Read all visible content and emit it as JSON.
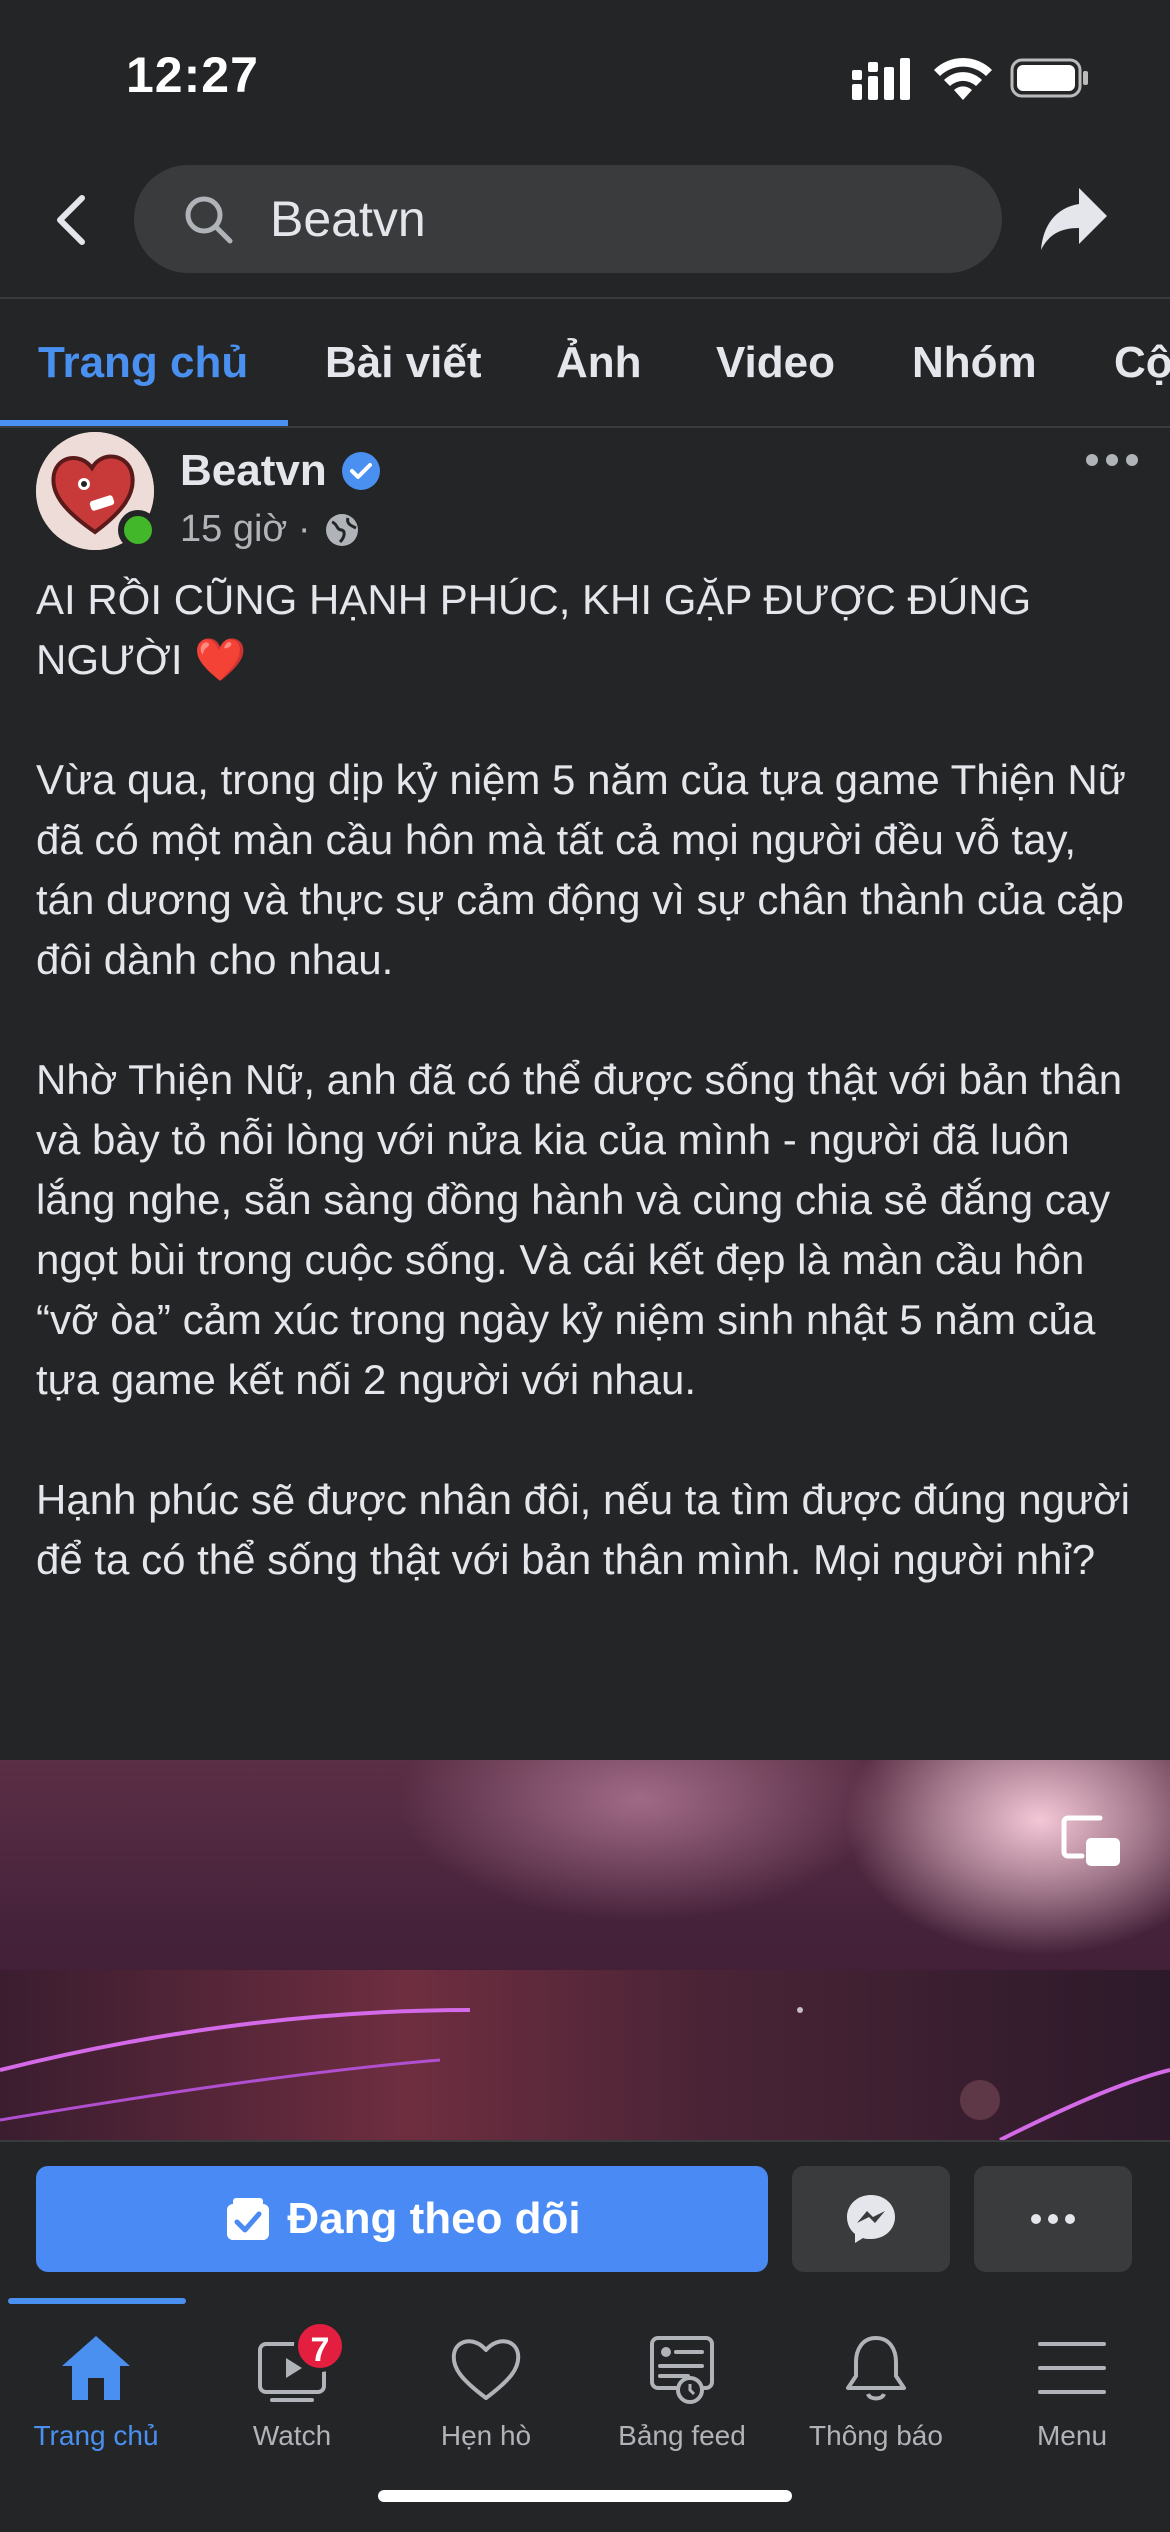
{
  "status_bar": {
    "time": "12:27"
  },
  "search": {
    "query": "Beatvn"
  },
  "tabs": [
    {
      "label": "Trang chủ",
      "active": true
    },
    {
      "label": "Bài viết"
    },
    {
      "label": "Ảnh"
    },
    {
      "label": "Video"
    },
    {
      "label": "Nhóm"
    },
    {
      "label": "Cộ"
    }
  ],
  "post": {
    "author": "Beatvn",
    "time": "15 giờ ·",
    "paragraphs": [
      "AI RỒI CŨNG HẠNH PHÚC, KHI GẶP ĐƯỢC ĐÚNG NGƯỜI ❤️",
      "Vừa qua, trong dịp kỷ niệm 5 năm của tựa game Thiện Nữ đã có một màn cầu hôn mà tất cả mọi người đều vỗ tay, tán dương và thực sự cảm động vì sự chân thành của cặp đôi dành cho nhau.",
      "Nhờ Thiện Nữ, anh đã có thể được sống thật với bản thân và bày tỏ nỗi lòng với nửa kia của mình - người đã luôn lắng nghe, sẵn sàng đồng hành và cùng chia sẻ đắng cay ngọt bùi trong cuộc sống. Và cái kết đẹp là màn cầu hôn “vỡ òa” cảm xúc trong ngày kỷ niệm sinh nhật 5 năm của tựa game kết nối 2 người với nhau.",
      "Hạnh phúc sẽ được nhân đôi, nếu ta tìm được đúng người để ta có thể sống thật với bản thân mình. Mọi người nhỉ?"
    ]
  },
  "actions": {
    "follow_label": "Đang theo dõi"
  },
  "bottom_nav": [
    {
      "label": "Trang chủ",
      "icon": "home-icon",
      "active": true
    },
    {
      "label": "Watch",
      "icon": "watch-icon",
      "badge": "7"
    },
    {
      "label": "Hẹn hò",
      "icon": "heart-icon"
    },
    {
      "label": "Bảng feed",
      "icon": "feed-icon"
    },
    {
      "label": "Thông báo",
      "icon": "bell-icon"
    },
    {
      "label": "Menu",
      "icon": "menu-icon"
    }
  ],
  "colors": {
    "accent": "#4a90f0",
    "background": "#242526",
    "badge": "#e41e3f",
    "online": "#42b72a"
  }
}
